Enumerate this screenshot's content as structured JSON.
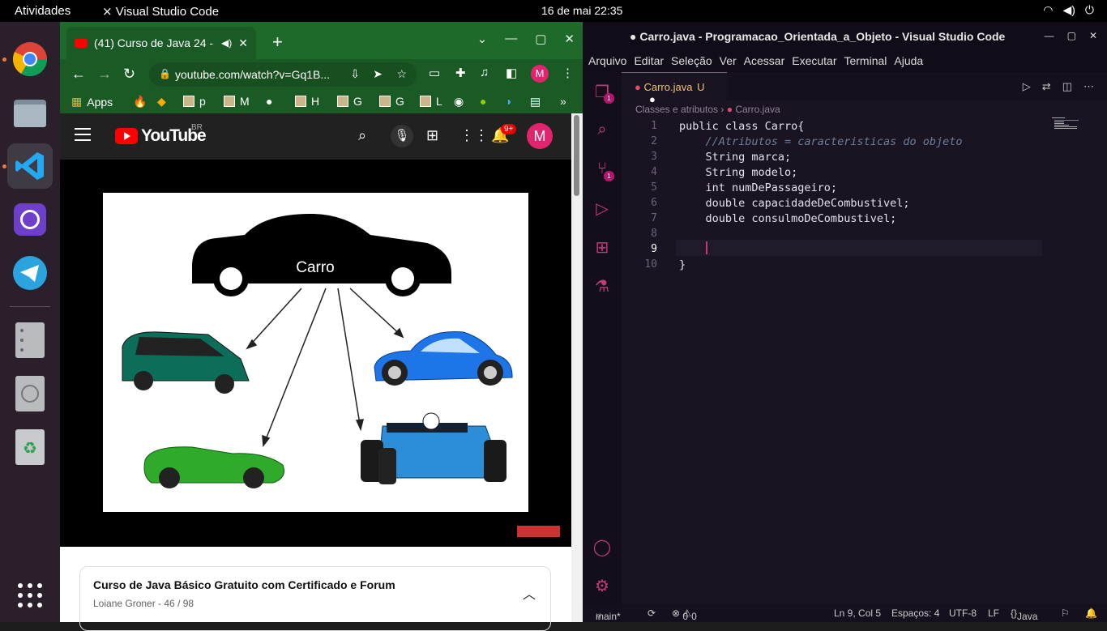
{
  "topbar": {
    "activities": "Atividades",
    "app_name": "Visual Studio Code",
    "date": "16 de mai",
    "time": "22:35"
  },
  "dock": {
    "items": [
      "chrome-icon",
      "files-icon",
      "vscode-icon",
      "github-desktop-icon",
      "telegram-icon",
      "server-icon",
      "disk-icon",
      "trash-icon",
      "apps-grid-icon"
    ]
  },
  "chrome": {
    "tab_title": "(41) Curso de Java 24 -",
    "url": "youtube.com/watch?v=Gq1B...",
    "profile": "M",
    "bookmarks": {
      "apps": "Apps",
      "p": "p",
      "m": "M",
      "h": "H",
      "g1": "G",
      "g2": "G",
      "l": "L"
    }
  },
  "youtube": {
    "logo_text": "YouTube",
    "region": "BR",
    "notif_count": "9+",
    "avatar": "M"
  },
  "slide": {
    "center_label": "Carro"
  },
  "playlist": {
    "title": "Curso de Java Básico Gratuito com Certificado e Forum",
    "subtitle": "Loiane Groner - 46 / 98"
  },
  "vscode": {
    "title": "● Carro.java - Programacao_Orientada_a_Objeto - Visual Studio Code",
    "menu": [
      "Arquivo",
      "Editar",
      "Seleção",
      "Ver",
      "Acessar",
      "Executar",
      "Terminal",
      "Ajuda"
    ],
    "tab": {
      "name": "Carro.java",
      "status": "U"
    },
    "breadcrumb": {
      "folder": "Classes e atributos",
      "file": "Carro.java"
    },
    "code": [
      {
        "n": "1",
        "text": "public class Carro{"
      },
      {
        "n": "2",
        "text": "    //Atributos = caracteristicas do objeto"
      },
      {
        "n": "3",
        "text": "    String marca;"
      },
      {
        "n": "4",
        "text": "    String modelo;"
      },
      {
        "n": "5",
        "text": "    int numDePassageiro;"
      },
      {
        "n": "6",
        "text": "    double capacidadeDeCombustivel;"
      },
      {
        "n": "7",
        "text": "    double consulmoDeCombustivel;"
      },
      {
        "n": "8",
        "text": ""
      },
      {
        "n": "9",
        "text": ""
      },
      {
        "n": "10",
        "text": "}"
      }
    ],
    "badges": {
      "explorer": "1",
      "scm": "1"
    },
    "status": {
      "branch": "main*",
      "errors": "0",
      "warnings": "0",
      "position": "Ln 9, Col 5",
      "spaces": "Espaços: 4",
      "encoding": "UTF-8",
      "eol": "LF",
      "language": "Java"
    }
  }
}
